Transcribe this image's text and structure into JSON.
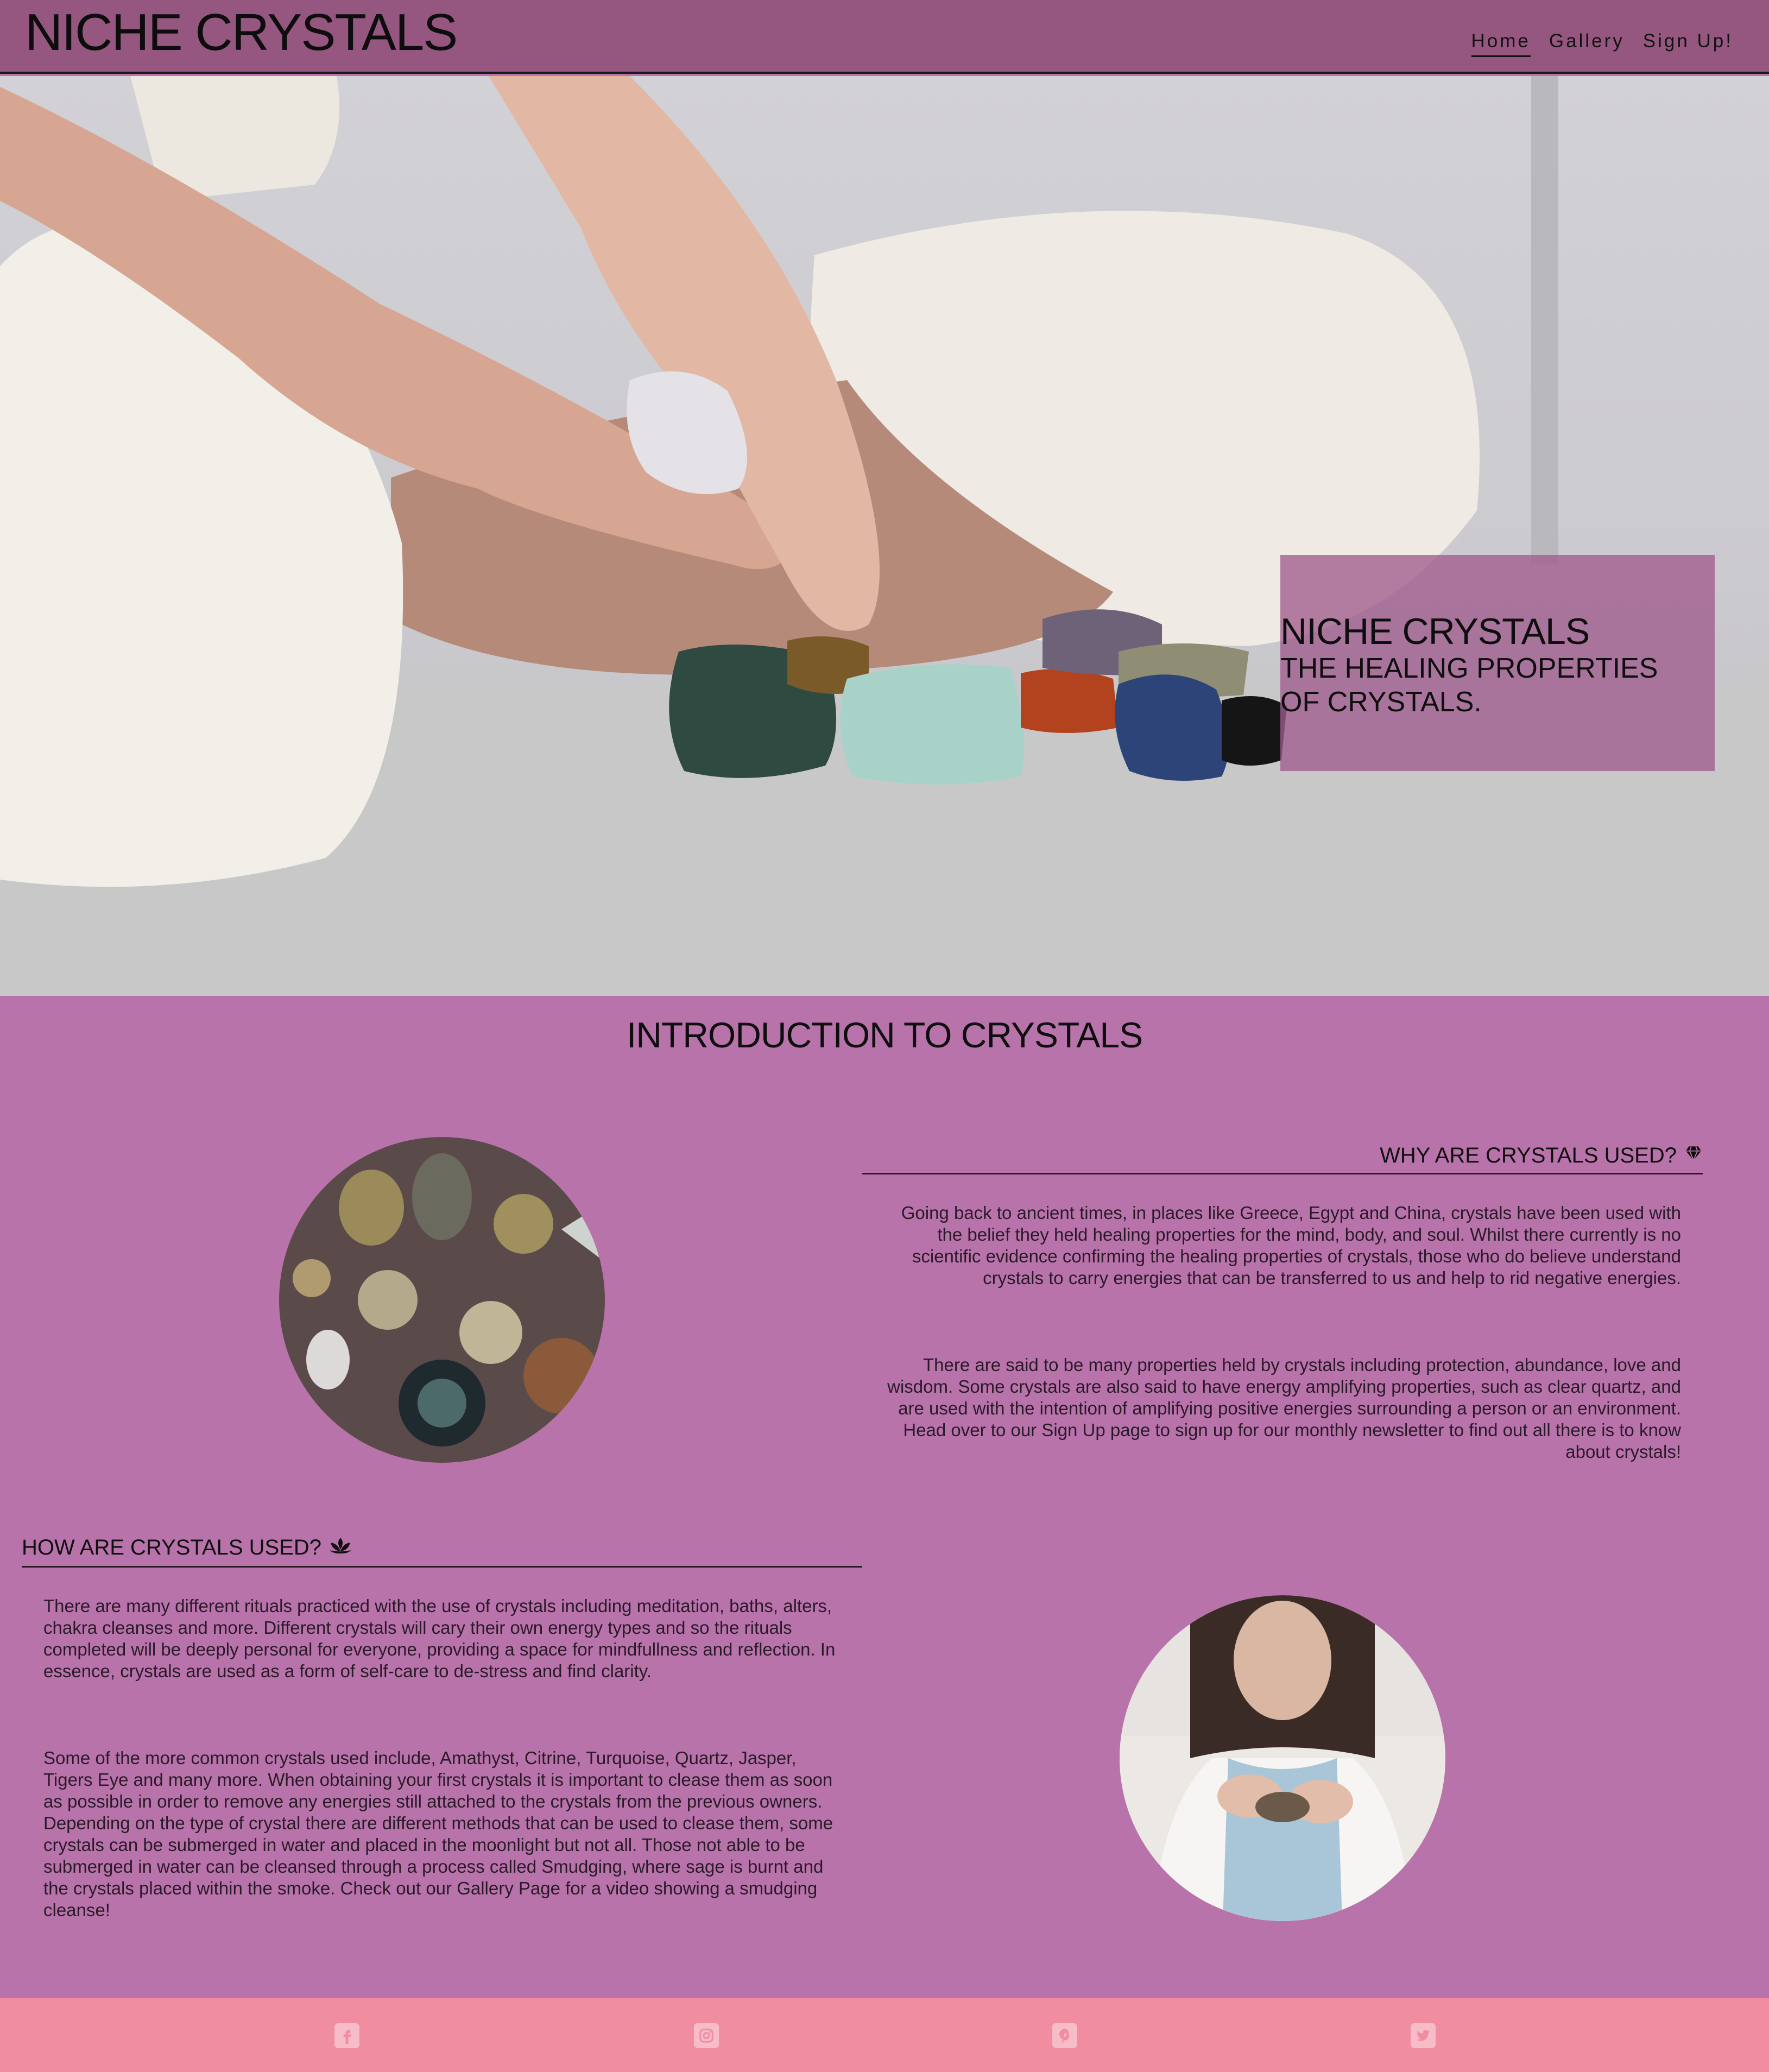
{
  "header": {
    "brand": "NICHE CRYSTALS",
    "nav": [
      {
        "label": "Home",
        "active": true
      },
      {
        "label": "Gallery",
        "active": false
      },
      {
        "label": "Sign Up!",
        "active": false
      }
    ]
  },
  "hero": {
    "title": "NICHE CRYSTALS",
    "subtitle": "THE HEALING PROPERTIES OF CRYSTALS.",
    "image_icon": "hands-holding-crystals-photo"
  },
  "intro": {
    "title": "INTRODUCTION TO CRYSTALS",
    "why": {
      "heading": "WHY ARE CRYSTALS USED?",
      "icon": "gem-icon",
      "paragraphs": [
        "Going back to ancient times, in places like Greece, Egypt and China, crystals have been used with the belief they held healing properties for the mind, body, and soul. Whilst there currently is no scientific evidence confirming the healing properties of crystals, those who do believe understand crystals to carry energies that can be transferred to us and help to rid negative energies.",
        "There are said to be many properties held by crystals including protection, abundance, love and wisdom. Some crystals are also said to have energy amplifying properties, such as clear quartz, and are used with the intention of amplifying positive energies surrounding a person or an environment. Head over to our Sign Up page to sign up for our monthly newsletter to find out all there is to know about crystals!"
      ]
    },
    "how": {
      "heading": "HOW ARE CRYSTALS USED?",
      "icon": "lotus-icon",
      "paragraphs": [
        "There are many different rituals practiced with the use of crystals including meditation, baths, alters, chakra cleanses and more. Different crystals will cary their own energy types and so the rituals completed will be deeply personal for everyone, providing a space for mindfullness and reflection. In essence, crystals are used as a form of self-care to de-stress and find clarity.",
        "Some of the more common crystals used include, Amathyst, Citrine, Turquoise, Quartz, Jasper, Tigers Eye and many more. When obtaining your first crystals it is important to clease them as soon as possible in order to remove any energies still attached to the crystals from the previous owners. Depending on the type of crystal there are different methods that can be used to clease them, some crystals can be submerged in water and placed in the moonlight but not all. Those not able to be submerged in water can be cleansed through a process called Smudging, where sage is burnt and the crystals placed within the smoke. Check out our Gallery Page for a video showing a smudging cleanse!"
      ]
    }
  },
  "footer": {
    "social": [
      "facebook-icon",
      "instagram-icon",
      "pinterest-icon",
      "twitter-icon"
    ]
  },
  "colors": {
    "header": "#95567f",
    "body": "#b873ab",
    "footer": "#f08da0",
    "social_icon": "#f6bdc8"
  }
}
